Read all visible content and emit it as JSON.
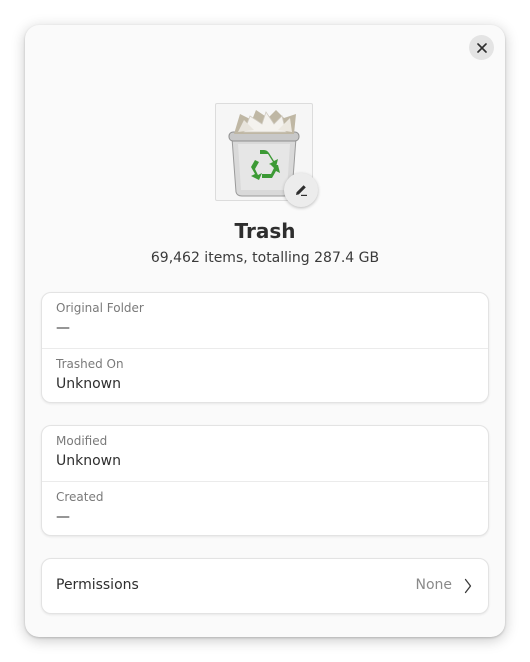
{
  "window": {
    "close_icon": "close-icon",
    "edit_icon": "pencil-icon",
    "file_icon": "trash-recycle-icon"
  },
  "header": {
    "title": "Trash",
    "summary": "69,462 items, totalling 287.4 GB"
  },
  "group_location": {
    "original_folder_label": "Original Folder",
    "original_folder_value": "—",
    "trashed_on_label": "Trashed On",
    "trashed_on_value": "Unknown"
  },
  "group_dates": {
    "modified_label": "Modified",
    "modified_value": "Unknown",
    "created_label": "Created",
    "created_value": "—"
  },
  "permissions": {
    "label": "Permissions",
    "value": "None",
    "chevron_icon": "chevron-right-icon"
  },
  "colors": {
    "window_bg": "#fafafa",
    "card_bg": "#ffffff",
    "recycle_green": "#3c9a35"
  }
}
